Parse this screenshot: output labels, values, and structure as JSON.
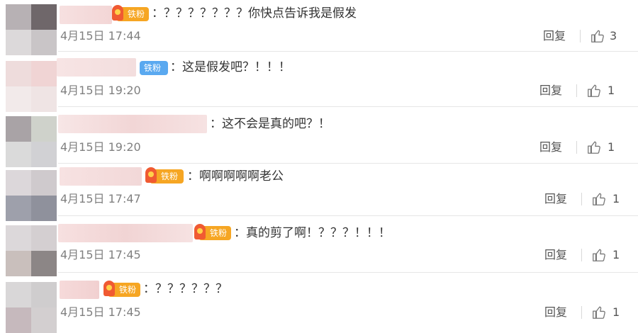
{
  "comments": [
    {
      "badge": "铁粉",
      "badge_type": "orange",
      "text": "：？？？？？？？你快点告诉我是假发",
      "time": "4月15日 17:44",
      "reply": "回复",
      "likes": "3"
    },
    {
      "badge": "铁粉",
      "badge_type": "blue",
      "text": "：这是假发吧？！！！",
      "time": "4月15日 19:20",
      "reply": "回复",
      "likes": "1"
    },
    {
      "badge": "",
      "badge_type": "none",
      "text": "：这不会是真的吧？！",
      "time": "4月15日 19:20",
      "reply": "回复",
      "likes": "1"
    },
    {
      "badge": "铁粉",
      "badge_type": "orange",
      "text": "：啊啊啊啊啊老公",
      "time": "4月15日 17:47",
      "reply": "回复",
      "likes": "1"
    },
    {
      "badge": "铁粉",
      "badge_type": "orange",
      "text": "：真的剪了啊！？？？！！！",
      "time": "4月15日 17:45",
      "reply": "回复",
      "likes": "1"
    },
    {
      "badge": "铁粉",
      "badge_type": "orange",
      "text": "：？？？？？？",
      "time": "4月15日 17:45",
      "reply": "回复",
      "likes": "1"
    }
  ],
  "colors": {
    "badge_orange": "#f6a623",
    "badge_blue": "#5aa9f0",
    "like_icon": "#777777"
  },
  "icons": {
    "like": "thumbs-up-icon",
    "badge": "fan-badge-icon"
  }
}
